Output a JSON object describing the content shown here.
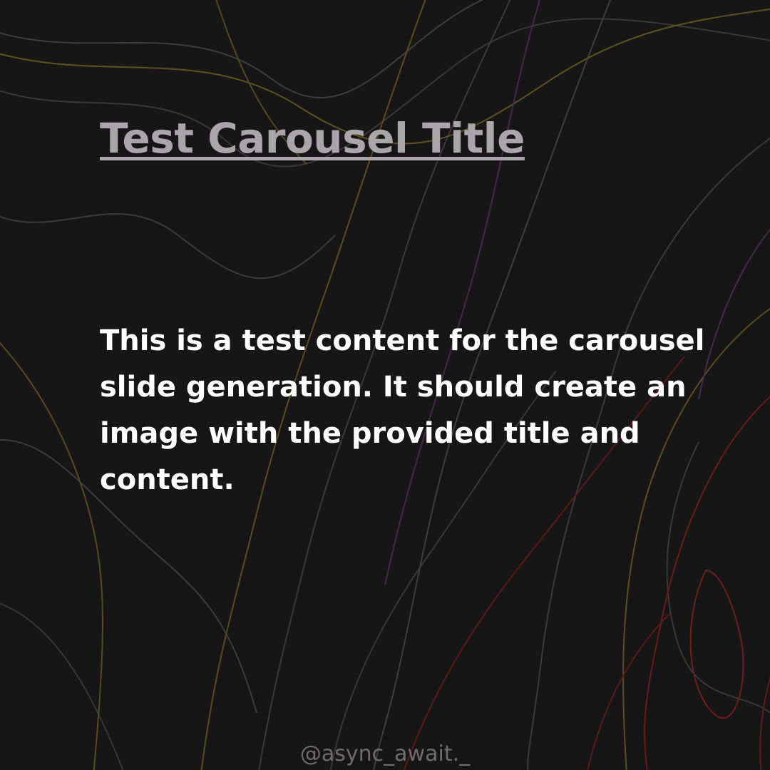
{
  "slide": {
    "title": "Test Carousel Title",
    "content": "This is a test content for the carousel slide generation. It should create an image with the provided title and content.",
    "handle": "@async_await._"
  },
  "colors": {
    "background": "#171616",
    "title": "#a8a6a8",
    "content": "#ffffff",
    "handle": "#6f6c6e",
    "line_gray": "#4a4848",
    "line_gold": "#6b5a1f",
    "line_red": "#7a1e1e",
    "line_purple": "#4d2f55"
  }
}
